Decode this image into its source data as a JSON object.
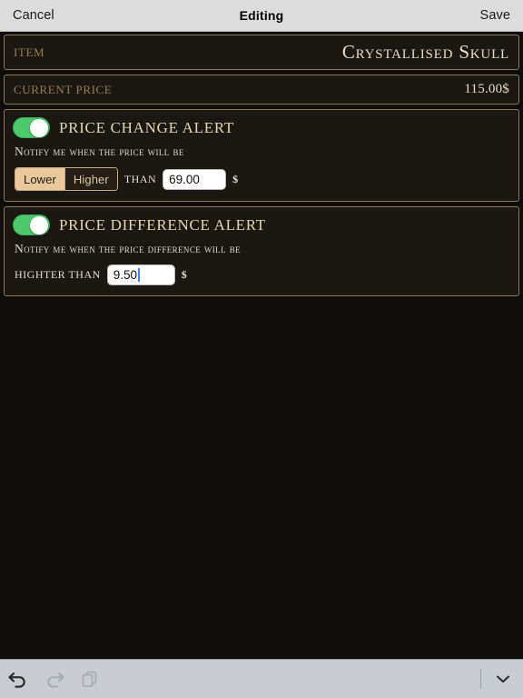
{
  "navbar": {
    "cancel_label": "Cancel",
    "title": "Editing",
    "save_label": "Save"
  },
  "item_row": {
    "label": "ITEM",
    "value": "Crystallised Skull"
  },
  "price_row": {
    "label": "CURRENT PRICE",
    "value": "115.00$"
  },
  "price_change_alert": {
    "toggle_state": "on",
    "title": "PRICE CHANGE ALERT",
    "subtitle": "Notify me when the price will be",
    "options": [
      "Lower",
      "Higher"
    ],
    "selected_option": "Lower",
    "than_label": "THAN",
    "input_value": "69.00",
    "currency": "$"
  },
  "price_difference_alert": {
    "toggle_state": "on",
    "title": "PRICE DIFFERENCE ALERT",
    "subtitle": "Notify me when the price difference will be",
    "than_label": "HIGHTER THAN",
    "input_value": "9.50",
    "currency": "$",
    "has_cursor": true
  },
  "toolbar": {
    "undo_icon": "undo-arrow-icon",
    "redo_icon": "redo-arrow-icon",
    "paste_icon": "paste-icon",
    "dismiss_icon": "chevron-down-icon"
  },
  "colors": {
    "background": "#100e0c",
    "panel_fill": "#1b1814",
    "panel_border": "#907754",
    "gold_text": "#eadcc0",
    "label_brown": "#9b7c4f",
    "toggle_on": "#4cc96a",
    "segment_selected": "#e9c89c",
    "navbar_bg": "#dcdcdc",
    "toolbar_bg": "#c9ccd2",
    "caret_blue": "#3b82f6"
  }
}
